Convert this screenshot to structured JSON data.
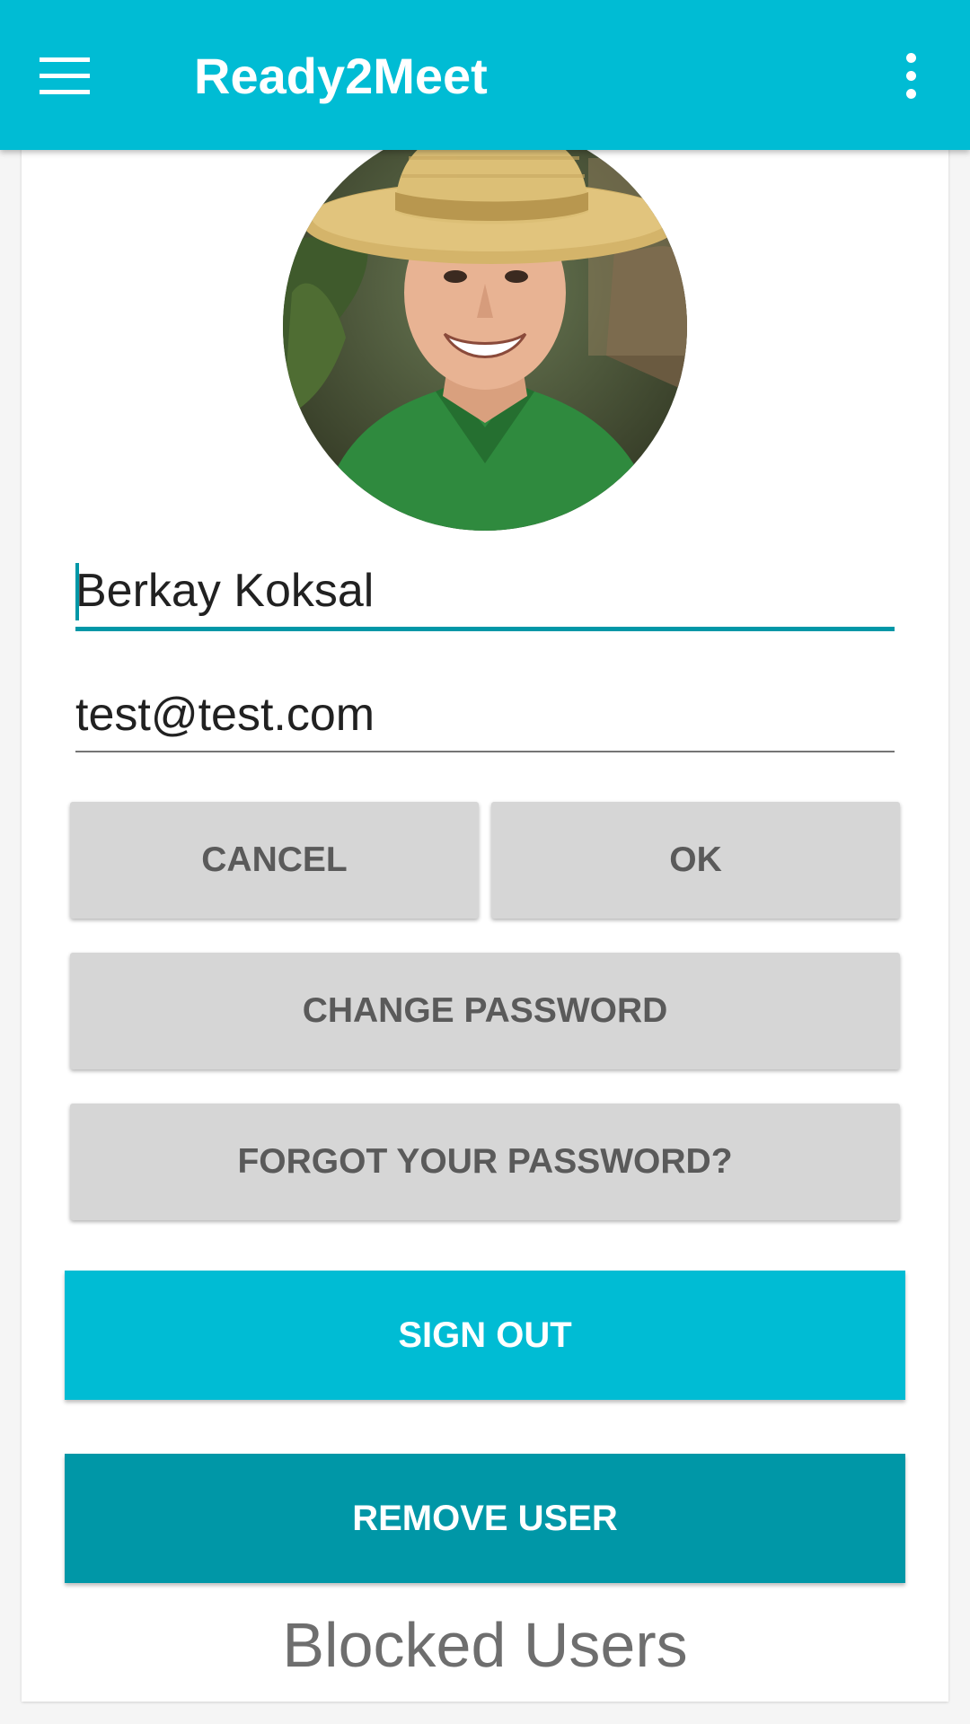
{
  "app_bar": {
    "title": "Ready2Meet",
    "menu_icon": "hamburger-menu-icon",
    "overflow_icon": "more-vert-icon",
    "color": "#00bcd4"
  },
  "profile": {
    "name_value": "Berkay Koksal",
    "email_value": "test@test.com"
  },
  "buttons": {
    "cancel": "CANCEL",
    "ok": "OK",
    "change_password": "CHANGE PASSWORD",
    "forgot_password": "FORGOT YOUR PASSWORD?",
    "sign_out": "SIGN OUT",
    "remove_user": "REMOVE USER"
  },
  "colors": {
    "accent": "#00bcd4",
    "accent_dark": "#0097a7"
  },
  "blocked_users": {
    "heading": "Blocked Users"
  }
}
